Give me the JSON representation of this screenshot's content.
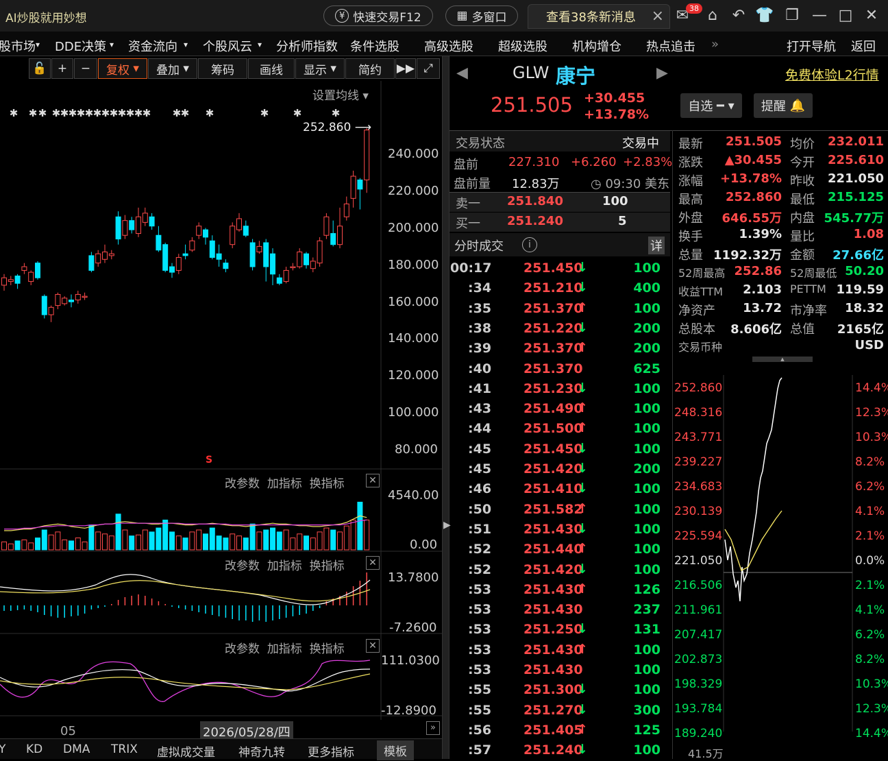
{
  "app": {
    "title": "AI炒股就用妙想",
    "quick_trade": "快速交易F12",
    "multi_window": "多窗口",
    "new_messages": "查看38条新消息",
    "badge": "38"
  },
  "menu": [
    "股市场",
    "DDE决策",
    "资金流向",
    "个股风云",
    "分析师指数",
    "条件选股",
    "高级选股",
    "超级选股",
    "机构增仓",
    "热点追击",
    "»",
    "打开导航",
    "返回"
  ],
  "ktool": {
    "fuquan": "复权",
    "overlay": "叠加",
    "chips": "筹码",
    "draw": "画线",
    "display": "显示",
    "simple": "简约",
    "set_ma": "设置均线"
  },
  "kchart": {
    "y_ticks": [
      "240.000",
      "220.000",
      "200.000",
      "180.000",
      "160.000",
      "140.000",
      "120.000",
      "100.000",
      "80.000"
    ],
    "high_label": "252.860",
    "x_month": "05",
    "cursor_date": "2026/05/28/四",
    "s_marker": "S"
  },
  "panels": {
    "edit": "改参数",
    "add": "加指标",
    "swap": "换指标",
    "vol_top": "4540.00",
    "vol_bot": "0.00",
    "macd_top": "13.7800",
    "macd_bot": "-7.2600",
    "kdj_top": "111.0300",
    "kdj_bot": "-12.8900"
  },
  "bottom_tabs": [
    "Y",
    "KD",
    "DMA",
    "TRIX",
    "虚拟成交量",
    "神奇九转",
    "更多指标",
    "模板"
  ],
  "quote": {
    "code": "GLW",
    "name": "康宁",
    "l2": "免费体验L2行情",
    "price": "251.505",
    "change": "+30.455",
    "change_pct": "+13.78%",
    "watch": "自选",
    "alert": "提醒"
  },
  "status": {
    "label": "交易状态",
    "value": "交易中",
    "pre_label": "盘前",
    "pre_price": "227.310",
    "pre_chg": "+6.260",
    "pre_pct": "+2.83%",
    "pre_vol_label": "盘前量",
    "pre_vol": "12.83万",
    "pre_time": "09:30 美东",
    "ask_label": "卖一",
    "ask_price": "251.840",
    "ask_vol": "100",
    "bid_label": "买一",
    "bid_price": "251.240",
    "bid_vol": "5",
    "ticks_label": "分时成交",
    "detail": "详"
  },
  "stats": [
    [
      "最新",
      "251.505",
      "red",
      "均价",
      "232.011",
      "red"
    ],
    [
      "涨跌",
      "▲30.455",
      "red",
      "今开",
      "225.610",
      "red"
    ],
    [
      "涨幅",
      "+13.78%",
      "red",
      "昨收",
      "221.050",
      "wht"
    ],
    [
      "最高",
      "252.860",
      "red",
      "最低",
      "215.125",
      "grn"
    ],
    [
      "外盘",
      "646.55万",
      "red",
      "内盘",
      "545.77万",
      "grn"
    ],
    [
      "换手",
      "1.39%",
      "wht",
      "量比",
      "1.08",
      "red"
    ],
    [
      "总量",
      "1192.32万",
      "wht",
      "金额",
      "27.66亿",
      "cyn"
    ],
    [
      "52周最高",
      "252.86",
      "red",
      "52周最低",
      "50.20",
      "grn"
    ],
    [
      "收益TTM",
      "2.103",
      "wht",
      "PETTM",
      "119.59",
      "wht"
    ],
    [
      "净资产",
      "13.72",
      "wht",
      "市净率",
      "18.32",
      "wht"
    ],
    [
      "总股本",
      "8.606亿",
      "wht",
      "总值",
      "2165亿",
      "wht"
    ],
    [
      "交易币种",
      "",
      "wht",
      "",
      "USD",
      "wht"
    ]
  ],
  "ticks": [
    [
      "00:17",
      "251.450",
      "d",
      "100"
    ],
    [
      ":34",
      "251.210",
      "d",
      "400"
    ],
    [
      ":35",
      "251.370",
      "u",
      "100"
    ],
    [
      ":38",
      "251.220",
      "d",
      "200"
    ],
    [
      ":39",
      "251.370",
      "u",
      "200"
    ],
    [
      ":40",
      "251.370",
      "",
      "625"
    ],
    [
      ":41",
      "251.230",
      "d",
      "100"
    ],
    [
      ":43",
      "251.490",
      "u",
      "100"
    ],
    [
      ":44",
      "251.500",
      "u",
      "100"
    ],
    [
      ":45",
      "251.450",
      "d",
      "100"
    ],
    [
      ":45",
      "251.420",
      "d",
      "200"
    ],
    [
      ":46",
      "251.410",
      "d",
      "100"
    ],
    [
      ":50",
      "251.582",
      "u",
      "100"
    ],
    [
      ":51",
      "251.430",
      "d",
      "100"
    ],
    [
      ":52",
      "251.440",
      "u",
      "100"
    ],
    [
      ":52",
      "251.420",
      "d",
      "100"
    ],
    [
      ":53",
      "251.430",
      "u",
      "126"
    ],
    [
      ":53",
      "251.430",
      "",
      "237"
    ],
    [
      ":53",
      "251.250",
      "d",
      "131"
    ],
    [
      ":53",
      "251.430",
      "u",
      "100"
    ],
    [
      ":53",
      "251.430",
      "",
      "100"
    ],
    [
      ":55",
      "251.300",
      "d",
      "100"
    ],
    [
      ":55",
      "251.270",
      "d",
      "300"
    ],
    [
      ":56",
      "251.405",
      "u",
      "125"
    ],
    [
      ":57",
      "251.240",
      "d",
      "100"
    ]
  ],
  "intraday": {
    "left": [
      "252.860",
      "248.316",
      "243.771",
      "239.227",
      "234.683",
      "230.139",
      "225.594",
      "221.050",
      "216.506",
      "211.961",
      "207.417",
      "202.873",
      "198.329",
      "193.784",
      "189.240"
    ],
    "right": [
      "14.4%",
      "12.3%",
      "10.3%",
      "8.2%",
      "6.2%",
      "4.1%",
      "2.1%",
      "0.0%",
      "2.1%",
      "4.1%",
      "6.2%",
      "8.2%",
      "10.3%",
      "12.3%",
      "14.4%"
    ],
    "vol": "41.5万"
  },
  "colors": {
    "up": "#ff4b4b",
    "down": "#00e5ff",
    "tick_down": "#00e05a"
  }
}
